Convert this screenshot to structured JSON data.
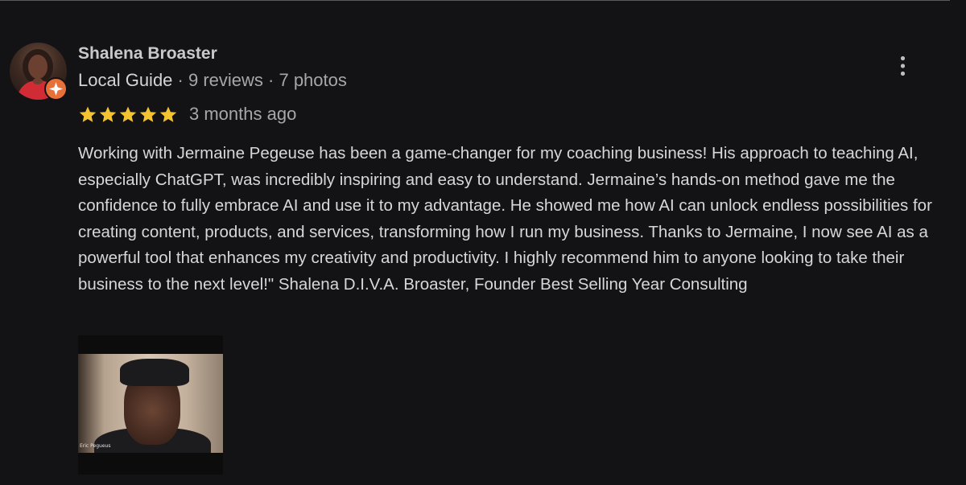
{
  "review": {
    "reviewer": {
      "name": "Shalena Broaster",
      "badge": "Local Guide",
      "reviews": "9 reviews",
      "photos": "7 photos",
      "separator": " · ",
      "avatar_icon": "user-avatar-photo",
      "badge_icon": "local-guide-star-badge"
    },
    "rating": {
      "stars": 5,
      "max": 5,
      "star_color": "#f4c430",
      "time_ago": "3 months ago"
    },
    "text": "Working with Jermaine Pegeuse has been a game-changer for my coaching business! His approach to teaching AI, especially ChatGPT, was incredibly inspiring and easy to understand. Jermaine’s hands-on method gave me the confidence to fully embrace AI and use it to my advantage. He showed me how AI can unlock endless possibilities for creating content, products, and services, transforming how I run my business. Thanks to Jermaine, I now see AI as a powerful tool that enhances my creativity and productivity. I highly recommend him to anyone looking to take their business to the next level!\" Shalena D.I.V.A. Broaster, Founder Best Selling Year Consulting",
    "photo": {
      "caption": "Eric Pegueus"
    },
    "menu_icon": "more-vertical-icon"
  },
  "colors": {
    "background": "#131315",
    "badge_orange": "#e8713a",
    "text_primary": "#d7d7d9",
    "text_secondary": "#a7a7aa"
  }
}
